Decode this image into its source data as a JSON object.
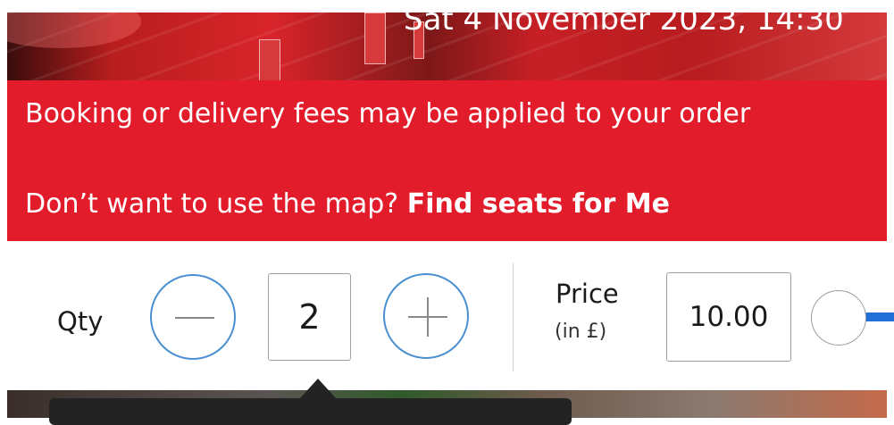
{
  "event": {
    "date_time": "Sat 4 November 2023, 14:30"
  },
  "banner": {
    "fees_notice": "Booking or delivery fees may be applied to your order",
    "map_prompt": "Don’t want to use the map?",
    "find_seats_link": "Find seats for Me",
    "background_color": "#e21c2a"
  },
  "quantity": {
    "label": "Qty",
    "value": "2",
    "decrement_icon": "minus-icon",
    "increment_icon": "plus-icon"
  },
  "price": {
    "label": "Price",
    "unit": "(in £)",
    "value": "10.00"
  },
  "colors": {
    "accent_blue": "#1f6fd6",
    "button_border": "#4a8fd0"
  }
}
